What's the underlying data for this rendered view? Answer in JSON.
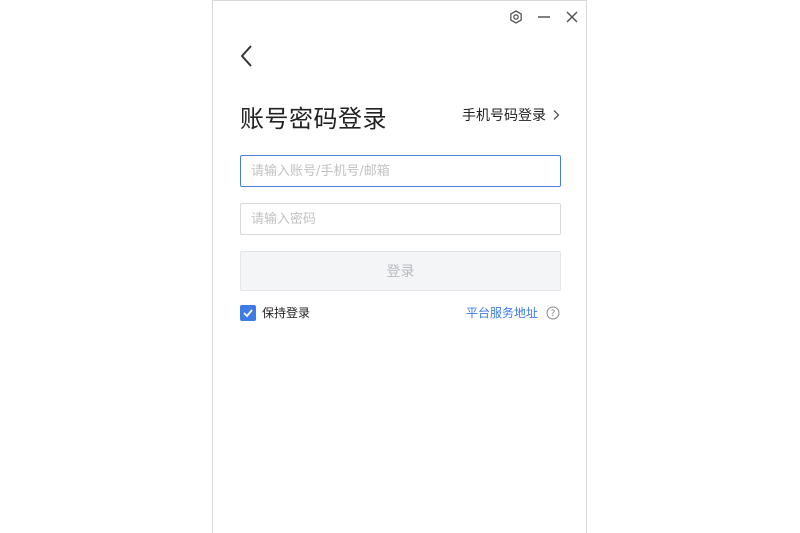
{
  "window": {
    "title_icons": [
      "settings-icon",
      "minimize-icon",
      "close-icon"
    ]
  },
  "header": {
    "title": "账号密码登录",
    "alt_login_label": "手机号码登录"
  },
  "form": {
    "account_placeholder": "请输入账号/手机号/邮箱",
    "account_value": "",
    "password_placeholder": "请输入密码",
    "password_value": "",
    "login_button_label": "登录"
  },
  "options": {
    "remember_label": "保持登录",
    "remember_checked": true,
    "server_link_label": "平台服务地址"
  },
  "colors": {
    "accent": "#3d7be6",
    "focus_border": "#4a7fe0",
    "disabled_button_bg": "#f4f5f7",
    "disabled_button_text": "#b9bcc2"
  }
}
